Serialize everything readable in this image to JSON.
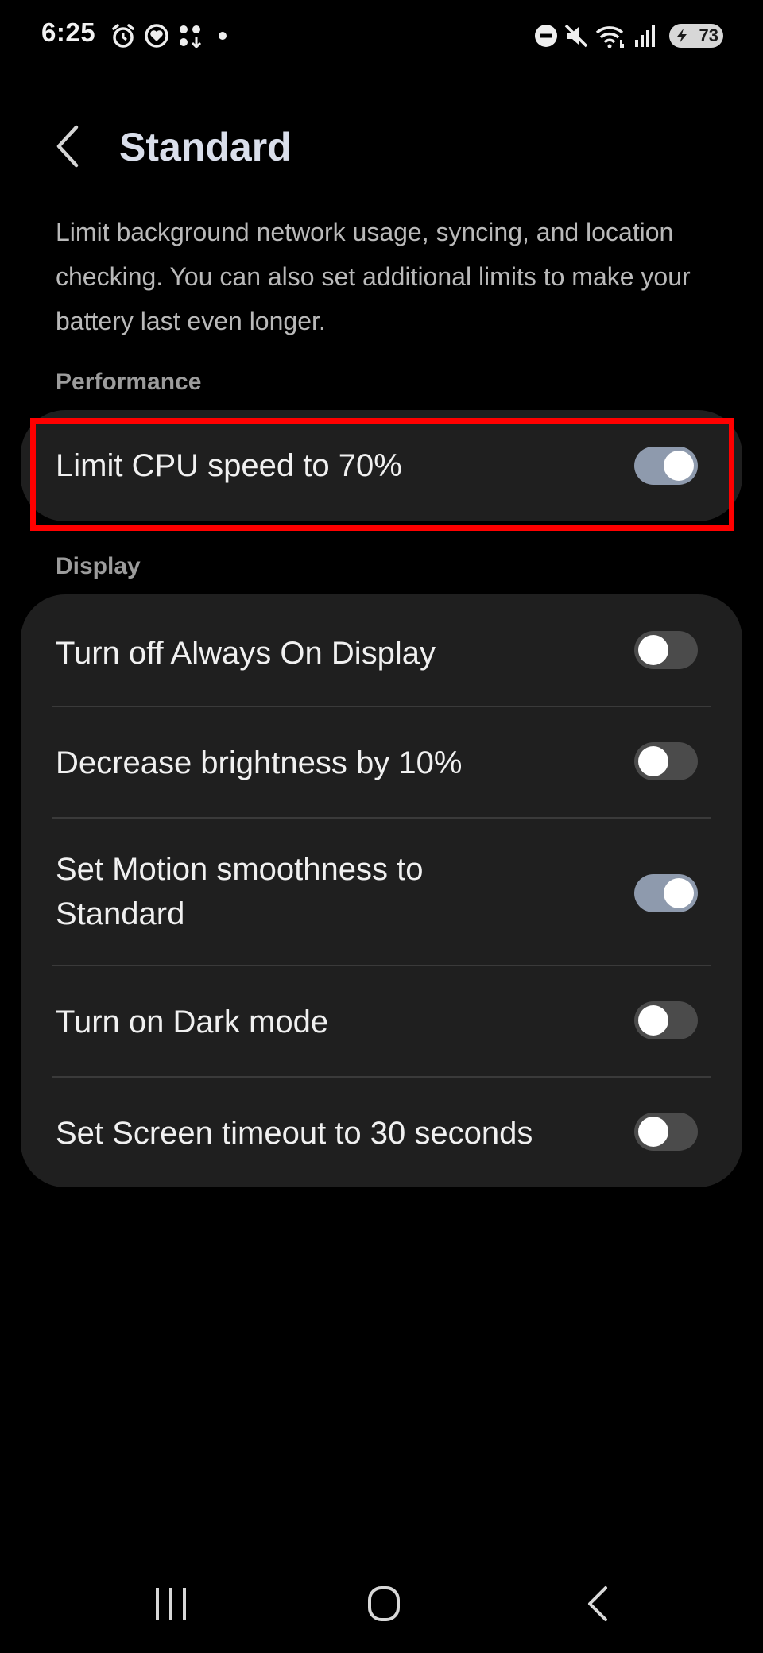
{
  "status_bar": {
    "time": "6:25",
    "battery_level": "73",
    "left_icons": [
      "alarm-icon",
      "health-icon",
      "apps-icon",
      "dot-icon"
    ],
    "right_icons": [
      "do-not-disturb-icon",
      "mute-icon",
      "wifi-icon",
      "signal-icon",
      "battery-icon"
    ]
  },
  "header": {
    "title": "Standard",
    "back_icon": "chevron-left-icon"
  },
  "description": "Limit background network usage, syncing, and location checking. You can also set additional limits to make your battery last even longer.",
  "sections": [
    {
      "header": "Performance",
      "items": [
        {
          "label": "Limit CPU speed to 70%",
          "enabled": true
        }
      ]
    },
    {
      "header": "Display",
      "items": [
        {
          "label": "Turn off Always On Display",
          "enabled": false
        },
        {
          "label": "Decrease brightness by 10%",
          "enabled": false
        },
        {
          "label": "Set Motion smoothness to Standard",
          "enabled": true
        },
        {
          "label": "Turn on Dark mode",
          "enabled": false
        },
        {
          "label": "Set Screen timeout to 30 seconds",
          "enabled": false
        }
      ]
    }
  ],
  "nav_bar": {
    "icons": [
      "recent-apps-icon",
      "home-icon",
      "back-icon"
    ]
  },
  "colors": {
    "background": "#000000",
    "card": "#1f1f1f",
    "toggle_on": "#8e9aad",
    "toggle_off": "#4b4b4b",
    "highlight": "#ff0000"
  }
}
